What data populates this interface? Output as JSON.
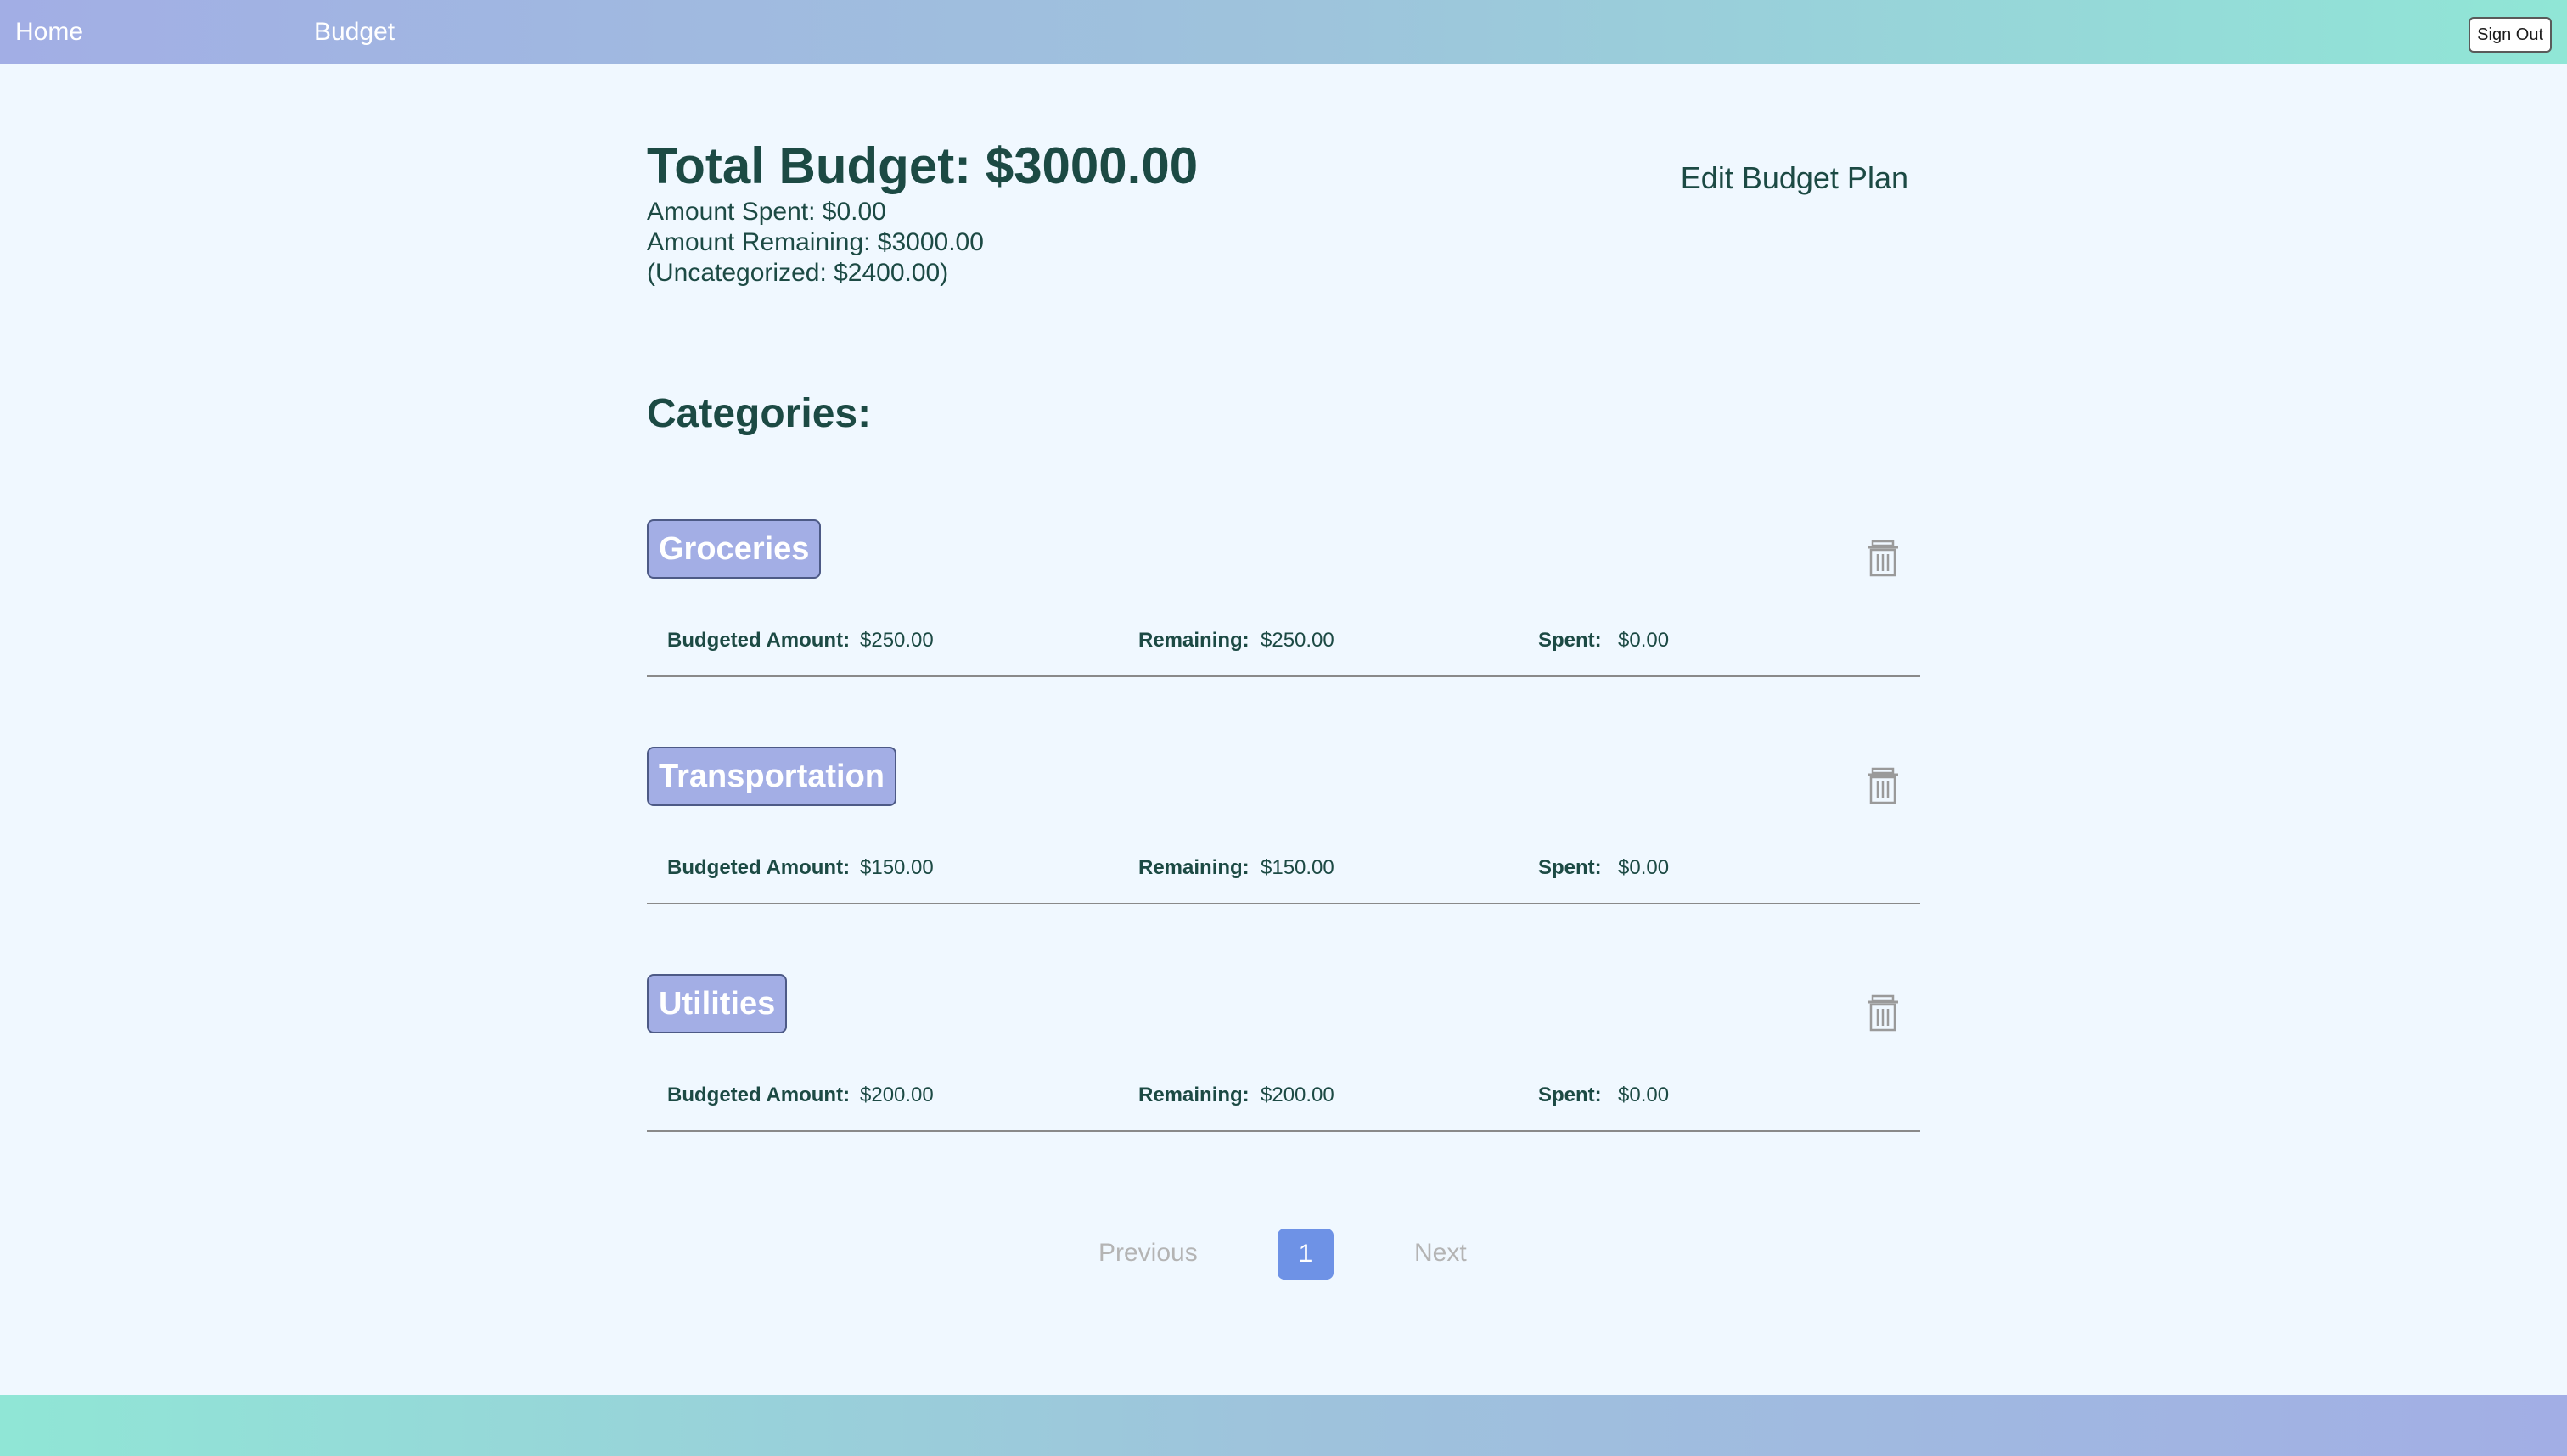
{
  "nav": {
    "home_label": "Home",
    "budget_label": "Budget",
    "signout_label": "Sign Out"
  },
  "summary": {
    "total_label": "Total Budget: $3000.00",
    "spent_label": "Amount Spent: $0.00",
    "remaining_label": "Amount Remaining: $3000.00",
    "uncategorized_label": "(Uncategorized: $2400.00)",
    "edit_plan_label": "Edit Budget Plan"
  },
  "categories_heading": "Categories:",
  "stat_labels": {
    "budgeted": "Budgeted Amount:",
    "remaining": "Remaining:",
    "spent": "Spent:"
  },
  "categories": [
    {
      "name": "Groceries",
      "budgeted": "$250.00",
      "remaining": "$250.00",
      "spent": "$0.00"
    },
    {
      "name": "Transportation",
      "budgeted": "$150.00",
      "remaining": "$150.00",
      "spent": "$0.00"
    },
    {
      "name": "Utilities",
      "budgeted": "$200.00",
      "remaining": "$200.00",
      "spent": "$0.00"
    }
  ],
  "pagination": {
    "previous_label": "Previous",
    "current_page": "1",
    "next_label": "Next"
  },
  "colors": {
    "heading_text": "#1c4a44",
    "category_badge": "#a3aee5",
    "current_page": "#6e92e6",
    "page_bg": "#f0f8ff"
  },
  "icons": {
    "delete": "trash-icon"
  }
}
